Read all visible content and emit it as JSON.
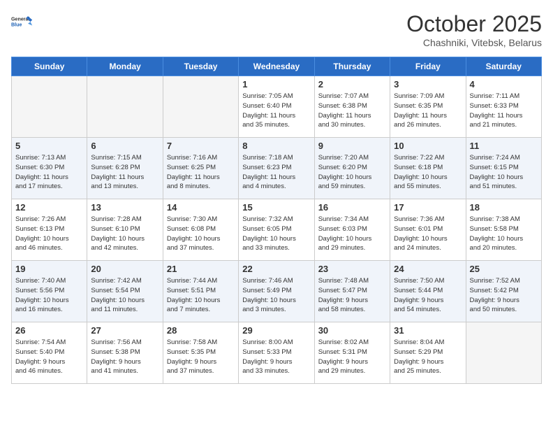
{
  "logo": {
    "line1": "General",
    "line2": "Blue"
  },
  "title": "October 2025",
  "subtitle": "Chashniki, Vitebsk, Belarus",
  "headers": [
    "Sunday",
    "Monday",
    "Tuesday",
    "Wednesday",
    "Thursday",
    "Friday",
    "Saturday"
  ],
  "weeks": [
    [
      {
        "day": "",
        "info": ""
      },
      {
        "day": "",
        "info": ""
      },
      {
        "day": "",
        "info": ""
      },
      {
        "day": "1",
        "info": "Sunrise: 7:05 AM\nSunset: 6:40 PM\nDaylight: 11 hours\nand 35 minutes."
      },
      {
        "day": "2",
        "info": "Sunrise: 7:07 AM\nSunset: 6:38 PM\nDaylight: 11 hours\nand 30 minutes."
      },
      {
        "day": "3",
        "info": "Sunrise: 7:09 AM\nSunset: 6:35 PM\nDaylight: 11 hours\nand 26 minutes."
      },
      {
        "day": "4",
        "info": "Sunrise: 7:11 AM\nSunset: 6:33 PM\nDaylight: 11 hours\nand 21 minutes."
      }
    ],
    [
      {
        "day": "5",
        "info": "Sunrise: 7:13 AM\nSunset: 6:30 PM\nDaylight: 11 hours\nand 17 minutes."
      },
      {
        "day": "6",
        "info": "Sunrise: 7:15 AM\nSunset: 6:28 PM\nDaylight: 11 hours\nand 13 minutes."
      },
      {
        "day": "7",
        "info": "Sunrise: 7:16 AM\nSunset: 6:25 PM\nDaylight: 11 hours\nand 8 minutes."
      },
      {
        "day": "8",
        "info": "Sunrise: 7:18 AM\nSunset: 6:23 PM\nDaylight: 11 hours\nand 4 minutes."
      },
      {
        "day": "9",
        "info": "Sunrise: 7:20 AM\nSunset: 6:20 PM\nDaylight: 10 hours\nand 59 minutes."
      },
      {
        "day": "10",
        "info": "Sunrise: 7:22 AM\nSunset: 6:18 PM\nDaylight: 10 hours\nand 55 minutes."
      },
      {
        "day": "11",
        "info": "Sunrise: 7:24 AM\nSunset: 6:15 PM\nDaylight: 10 hours\nand 51 minutes."
      }
    ],
    [
      {
        "day": "12",
        "info": "Sunrise: 7:26 AM\nSunset: 6:13 PM\nDaylight: 10 hours\nand 46 minutes."
      },
      {
        "day": "13",
        "info": "Sunrise: 7:28 AM\nSunset: 6:10 PM\nDaylight: 10 hours\nand 42 minutes."
      },
      {
        "day": "14",
        "info": "Sunrise: 7:30 AM\nSunset: 6:08 PM\nDaylight: 10 hours\nand 37 minutes."
      },
      {
        "day": "15",
        "info": "Sunrise: 7:32 AM\nSunset: 6:05 PM\nDaylight: 10 hours\nand 33 minutes."
      },
      {
        "day": "16",
        "info": "Sunrise: 7:34 AM\nSunset: 6:03 PM\nDaylight: 10 hours\nand 29 minutes."
      },
      {
        "day": "17",
        "info": "Sunrise: 7:36 AM\nSunset: 6:01 PM\nDaylight: 10 hours\nand 24 minutes."
      },
      {
        "day": "18",
        "info": "Sunrise: 7:38 AM\nSunset: 5:58 PM\nDaylight: 10 hours\nand 20 minutes."
      }
    ],
    [
      {
        "day": "19",
        "info": "Sunrise: 7:40 AM\nSunset: 5:56 PM\nDaylight: 10 hours\nand 16 minutes."
      },
      {
        "day": "20",
        "info": "Sunrise: 7:42 AM\nSunset: 5:54 PM\nDaylight: 10 hours\nand 11 minutes."
      },
      {
        "day": "21",
        "info": "Sunrise: 7:44 AM\nSunset: 5:51 PM\nDaylight: 10 hours\nand 7 minutes."
      },
      {
        "day": "22",
        "info": "Sunrise: 7:46 AM\nSunset: 5:49 PM\nDaylight: 10 hours\nand 3 minutes."
      },
      {
        "day": "23",
        "info": "Sunrise: 7:48 AM\nSunset: 5:47 PM\nDaylight: 9 hours\nand 58 minutes."
      },
      {
        "day": "24",
        "info": "Sunrise: 7:50 AM\nSunset: 5:44 PM\nDaylight: 9 hours\nand 54 minutes."
      },
      {
        "day": "25",
        "info": "Sunrise: 7:52 AM\nSunset: 5:42 PM\nDaylight: 9 hours\nand 50 minutes."
      }
    ],
    [
      {
        "day": "26",
        "info": "Sunrise: 7:54 AM\nSunset: 5:40 PM\nDaylight: 9 hours\nand 46 minutes."
      },
      {
        "day": "27",
        "info": "Sunrise: 7:56 AM\nSunset: 5:38 PM\nDaylight: 9 hours\nand 41 minutes."
      },
      {
        "day": "28",
        "info": "Sunrise: 7:58 AM\nSunset: 5:35 PM\nDaylight: 9 hours\nand 37 minutes."
      },
      {
        "day": "29",
        "info": "Sunrise: 8:00 AM\nSunset: 5:33 PM\nDaylight: 9 hours\nand 33 minutes."
      },
      {
        "day": "30",
        "info": "Sunrise: 8:02 AM\nSunset: 5:31 PM\nDaylight: 9 hours\nand 29 minutes."
      },
      {
        "day": "31",
        "info": "Sunrise: 8:04 AM\nSunset: 5:29 PM\nDaylight: 9 hours\nand 25 minutes."
      },
      {
        "day": "",
        "info": ""
      }
    ]
  ]
}
